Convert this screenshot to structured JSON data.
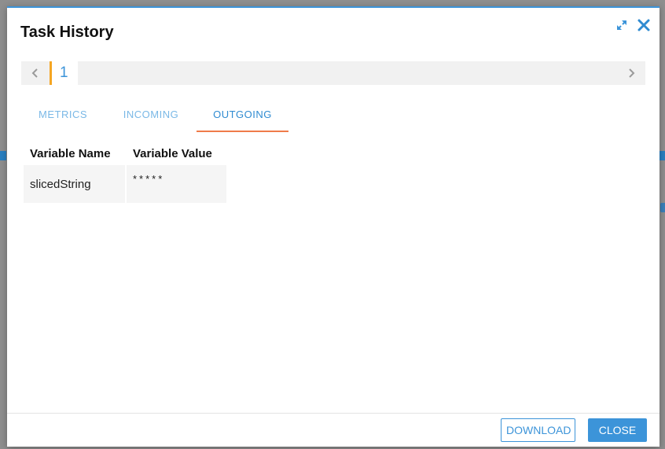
{
  "dialog": {
    "title": "Task History"
  },
  "pager": {
    "current_page": "1"
  },
  "tabs": [
    {
      "label": "METRICS",
      "active": false
    },
    {
      "label": "INCOMING",
      "active": false
    },
    {
      "label": "OUTGOING",
      "active": true
    }
  ],
  "variables_table": {
    "headers": [
      "Variable Name",
      "Variable Value"
    ],
    "rows": [
      {
        "name": "slicedString",
        "value": "*****"
      }
    ]
  },
  "footer": {
    "download_label": "DOWNLOAD",
    "close_label": "CLOSE"
  },
  "colors": {
    "accent": "#3c94d9",
    "tab_underline": "#ef7b4a",
    "page_marker": "#f5a623"
  },
  "icons": {
    "expand": "expand-icon",
    "close": "close-icon",
    "prev": "chevron-left-icon",
    "next": "chevron-right-icon"
  }
}
